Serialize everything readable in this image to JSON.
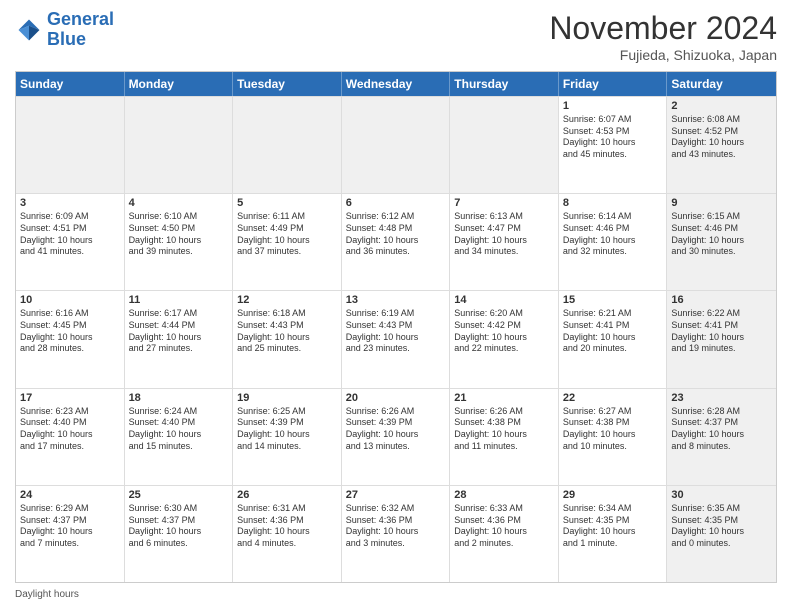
{
  "logo": {
    "line1": "General",
    "line2": "Blue"
  },
  "title": "November 2024",
  "subtitle": "Fujieda, Shizuoka, Japan",
  "days_of_week": [
    "Sunday",
    "Monday",
    "Tuesday",
    "Wednesday",
    "Thursday",
    "Friday",
    "Saturday"
  ],
  "footer": "Daylight hours",
  "weeks": [
    [
      {
        "day": "",
        "info": "",
        "shaded": true
      },
      {
        "day": "",
        "info": "",
        "shaded": true
      },
      {
        "day": "",
        "info": "",
        "shaded": true
      },
      {
        "day": "",
        "info": "",
        "shaded": true
      },
      {
        "day": "",
        "info": "",
        "shaded": true
      },
      {
        "day": "1",
        "info": "Sunrise: 6:07 AM\nSunset: 4:53 PM\nDaylight: 10 hours\nand 45 minutes.",
        "shaded": false
      },
      {
        "day": "2",
        "info": "Sunrise: 6:08 AM\nSunset: 4:52 PM\nDaylight: 10 hours\nand 43 minutes.",
        "shaded": true
      }
    ],
    [
      {
        "day": "3",
        "info": "Sunrise: 6:09 AM\nSunset: 4:51 PM\nDaylight: 10 hours\nand 41 minutes.",
        "shaded": false
      },
      {
        "day": "4",
        "info": "Sunrise: 6:10 AM\nSunset: 4:50 PM\nDaylight: 10 hours\nand 39 minutes.",
        "shaded": false
      },
      {
        "day": "5",
        "info": "Sunrise: 6:11 AM\nSunset: 4:49 PM\nDaylight: 10 hours\nand 37 minutes.",
        "shaded": false
      },
      {
        "day": "6",
        "info": "Sunrise: 6:12 AM\nSunset: 4:48 PM\nDaylight: 10 hours\nand 36 minutes.",
        "shaded": false
      },
      {
        "day": "7",
        "info": "Sunrise: 6:13 AM\nSunset: 4:47 PM\nDaylight: 10 hours\nand 34 minutes.",
        "shaded": false
      },
      {
        "day": "8",
        "info": "Sunrise: 6:14 AM\nSunset: 4:46 PM\nDaylight: 10 hours\nand 32 minutes.",
        "shaded": false
      },
      {
        "day": "9",
        "info": "Sunrise: 6:15 AM\nSunset: 4:46 PM\nDaylight: 10 hours\nand 30 minutes.",
        "shaded": true
      }
    ],
    [
      {
        "day": "10",
        "info": "Sunrise: 6:16 AM\nSunset: 4:45 PM\nDaylight: 10 hours\nand 28 minutes.",
        "shaded": false
      },
      {
        "day": "11",
        "info": "Sunrise: 6:17 AM\nSunset: 4:44 PM\nDaylight: 10 hours\nand 27 minutes.",
        "shaded": false
      },
      {
        "day": "12",
        "info": "Sunrise: 6:18 AM\nSunset: 4:43 PM\nDaylight: 10 hours\nand 25 minutes.",
        "shaded": false
      },
      {
        "day": "13",
        "info": "Sunrise: 6:19 AM\nSunset: 4:43 PM\nDaylight: 10 hours\nand 23 minutes.",
        "shaded": false
      },
      {
        "day": "14",
        "info": "Sunrise: 6:20 AM\nSunset: 4:42 PM\nDaylight: 10 hours\nand 22 minutes.",
        "shaded": false
      },
      {
        "day": "15",
        "info": "Sunrise: 6:21 AM\nSunset: 4:41 PM\nDaylight: 10 hours\nand 20 minutes.",
        "shaded": false
      },
      {
        "day": "16",
        "info": "Sunrise: 6:22 AM\nSunset: 4:41 PM\nDaylight: 10 hours\nand 19 minutes.",
        "shaded": true
      }
    ],
    [
      {
        "day": "17",
        "info": "Sunrise: 6:23 AM\nSunset: 4:40 PM\nDaylight: 10 hours\nand 17 minutes.",
        "shaded": false
      },
      {
        "day": "18",
        "info": "Sunrise: 6:24 AM\nSunset: 4:40 PM\nDaylight: 10 hours\nand 15 minutes.",
        "shaded": false
      },
      {
        "day": "19",
        "info": "Sunrise: 6:25 AM\nSunset: 4:39 PM\nDaylight: 10 hours\nand 14 minutes.",
        "shaded": false
      },
      {
        "day": "20",
        "info": "Sunrise: 6:26 AM\nSunset: 4:39 PM\nDaylight: 10 hours\nand 13 minutes.",
        "shaded": false
      },
      {
        "day": "21",
        "info": "Sunrise: 6:26 AM\nSunset: 4:38 PM\nDaylight: 10 hours\nand 11 minutes.",
        "shaded": false
      },
      {
        "day": "22",
        "info": "Sunrise: 6:27 AM\nSunset: 4:38 PM\nDaylight: 10 hours\nand 10 minutes.",
        "shaded": false
      },
      {
        "day": "23",
        "info": "Sunrise: 6:28 AM\nSunset: 4:37 PM\nDaylight: 10 hours\nand 8 minutes.",
        "shaded": true
      }
    ],
    [
      {
        "day": "24",
        "info": "Sunrise: 6:29 AM\nSunset: 4:37 PM\nDaylight: 10 hours\nand 7 minutes.",
        "shaded": false
      },
      {
        "day": "25",
        "info": "Sunrise: 6:30 AM\nSunset: 4:37 PM\nDaylight: 10 hours\nand 6 minutes.",
        "shaded": false
      },
      {
        "day": "26",
        "info": "Sunrise: 6:31 AM\nSunset: 4:36 PM\nDaylight: 10 hours\nand 4 minutes.",
        "shaded": false
      },
      {
        "day": "27",
        "info": "Sunrise: 6:32 AM\nSunset: 4:36 PM\nDaylight: 10 hours\nand 3 minutes.",
        "shaded": false
      },
      {
        "day": "28",
        "info": "Sunrise: 6:33 AM\nSunset: 4:36 PM\nDaylight: 10 hours\nand 2 minutes.",
        "shaded": false
      },
      {
        "day": "29",
        "info": "Sunrise: 6:34 AM\nSunset: 4:35 PM\nDaylight: 10 hours\nand 1 minute.",
        "shaded": false
      },
      {
        "day": "30",
        "info": "Sunrise: 6:35 AM\nSunset: 4:35 PM\nDaylight: 10 hours\nand 0 minutes.",
        "shaded": true
      }
    ]
  ]
}
